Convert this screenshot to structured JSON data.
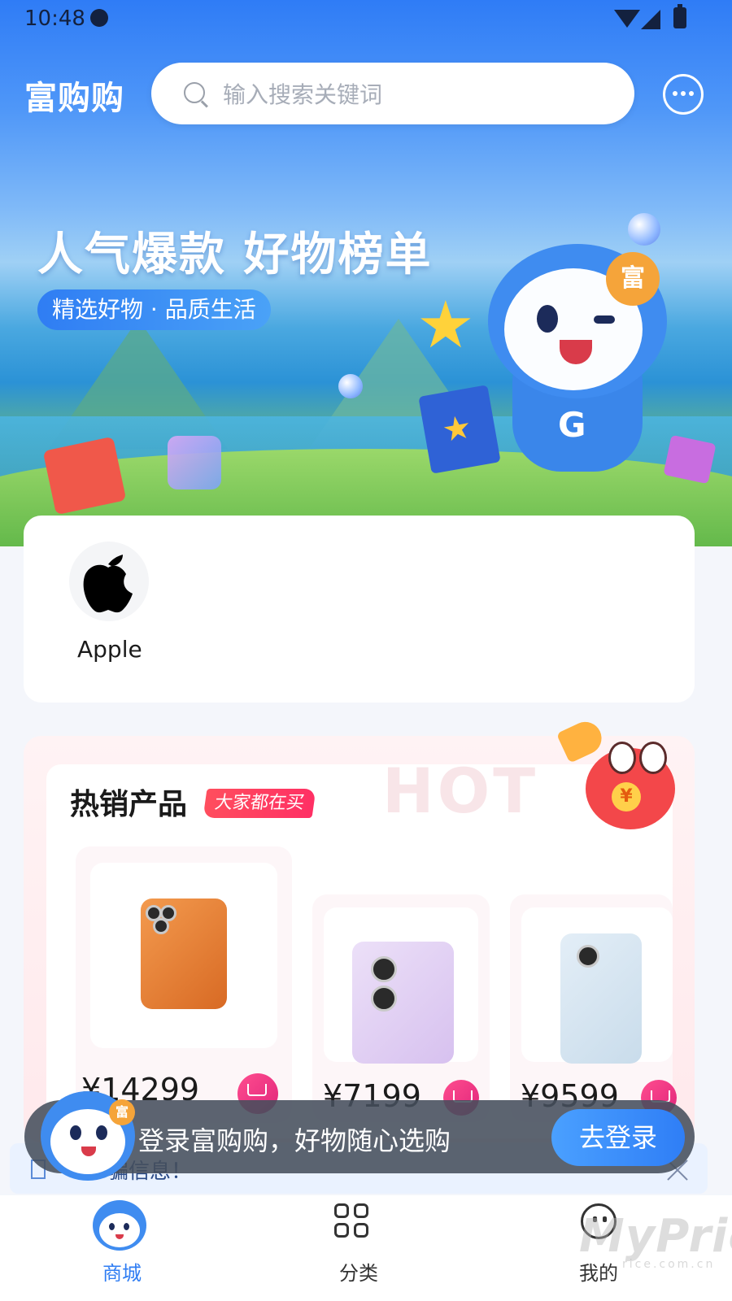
{
  "status_bar": {
    "time": "10:48"
  },
  "header": {
    "brand": "富购购",
    "search_placeholder": "输入搜索关键词"
  },
  "banner": {
    "title": "人气爆款 好物榜单",
    "tagline": "精选好物 · 品质生活",
    "mascot_badge": "富",
    "mascot_letter": "G"
  },
  "brands": [
    {
      "name": "Apple"
    }
  ],
  "hot": {
    "title": "热销产品",
    "tag": "大家都在买",
    "watermark": "HOT",
    "coin": "¥",
    "products": [
      {
        "price": "¥14299"
      },
      {
        "price": "¥7199"
      },
      {
        "price": "¥9599"
      }
    ]
  },
  "notice": {
    "text": "骗信息！"
  },
  "login_prompt": {
    "text": "登录富购购，好物随心选购",
    "button": "去登录",
    "badge": "富"
  },
  "tabs": [
    {
      "label": "商城",
      "active": true
    },
    {
      "label": "分类",
      "active": false
    },
    {
      "label": "我的",
      "active": false
    }
  ],
  "watermark": {
    "main": "MyPrice",
    "sub": "rice.com.cn"
  },
  "colors": {
    "primary": "#2f7df3",
    "accent": "#ff2f64",
    "cart": "#e0257a"
  }
}
